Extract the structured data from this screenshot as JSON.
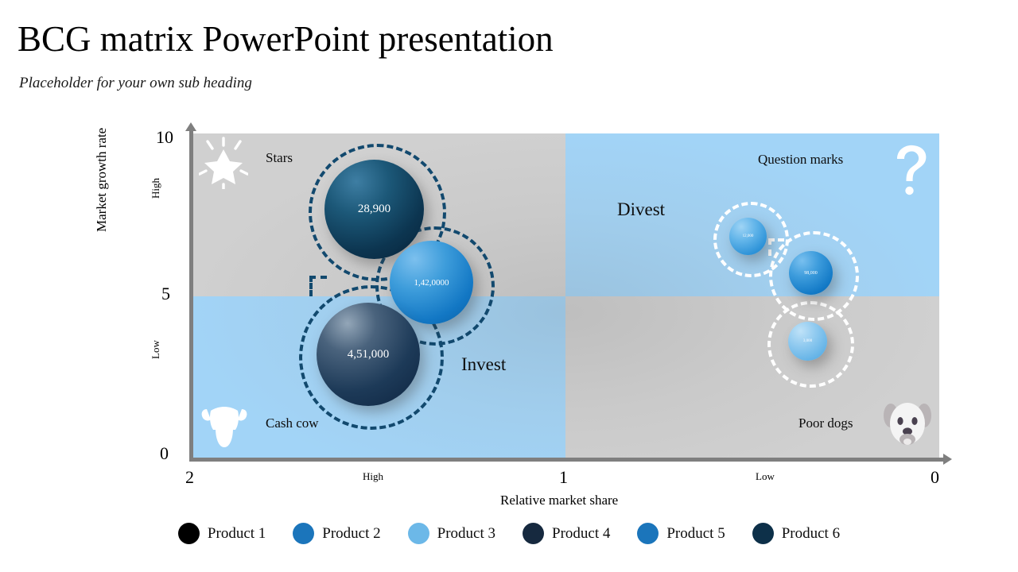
{
  "header": {
    "title": "BCG matrix PowerPoint presentation",
    "subtitle": "Placeholder for your own sub heading"
  },
  "chart_data": {
    "type": "scatter",
    "title": "BCG matrix PowerPoint presentation",
    "subtitle": "Placeholder for your own sub heading",
    "xlabel": "Relative market share",
    "ylabel": "Market growth rate",
    "xlim": [
      2,
      0
    ],
    "ylim": [
      0,
      10
    ],
    "x_ticks": [
      "2",
      "High",
      "1",
      "Low",
      "0"
    ],
    "y_ticks": [
      "10",
      "High",
      "5",
      "Low",
      "0"
    ],
    "grid": false,
    "legend_position": "bottom",
    "quadrants": [
      {
        "key": "stars",
        "label": "Stars",
        "icon": "star-icon",
        "color": "#d0d0d0",
        "position": "top-left"
      },
      {
        "key": "question",
        "label": "Question marks",
        "icon": "question-mark-icon",
        "color": "#a2d4f7",
        "position": "top-right"
      },
      {
        "key": "cashcow",
        "label": "Cash cow",
        "icon": "cow-icon",
        "color": "#a2d4f7",
        "position": "bottom-left"
      },
      {
        "key": "poordogs",
        "label": "Poor dogs",
        "icon": "dog-icon",
        "color": "#d0d0d0",
        "position": "bottom-right"
      }
    ],
    "action_labels": [
      {
        "key": "divest",
        "label": "Divest"
      },
      {
        "key": "invest",
        "label": "Invest"
      }
    ],
    "bubbles": [
      {
        "id": "b1",
        "label": "28,900",
        "x": 1.64,
        "y": 7.4,
        "size": 125,
        "color": "#0c3550",
        "ring": "dark"
      },
      {
        "id": "b2",
        "label": "1,42,0000",
        "x": 1.44,
        "y": 5.6,
        "size": 105,
        "color": "#1277c4",
        "ring": "dark"
      },
      {
        "id": "b3",
        "label": "4,51,000",
        "x": 1.67,
        "y": 3.5,
        "size": 130,
        "color": "#1d3a58",
        "ring": "dark"
      },
      {
        "id": "b4",
        "label": "12,000",
        "x": 0.54,
        "y": 6.5,
        "size": 47,
        "color": "#61b4e9",
        "ring": "light"
      },
      {
        "id": "b5",
        "label": "98,000",
        "x": 0.38,
        "y": 5.6,
        "size": 55,
        "color": "#1279c6",
        "ring": "light"
      },
      {
        "id": "b6",
        "label": "3,000",
        "x": 0.38,
        "y": 3.5,
        "size": 49,
        "color": "#8ec9ef",
        "ring": "light"
      }
    ],
    "legend": [
      {
        "label": "Product 1",
        "color": "#000000"
      },
      {
        "label": "Product 2",
        "color": "#1b75bb"
      },
      {
        "label": "Product 3",
        "color": "#6cb8e8"
      },
      {
        "label": "Product 4",
        "color": "#16293f"
      },
      {
        "label": "Product 5",
        "color": "#1b75bb"
      },
      {
        "label": "Product 6",
        "color": "#0d3049"
      }
    ]
  }
}
